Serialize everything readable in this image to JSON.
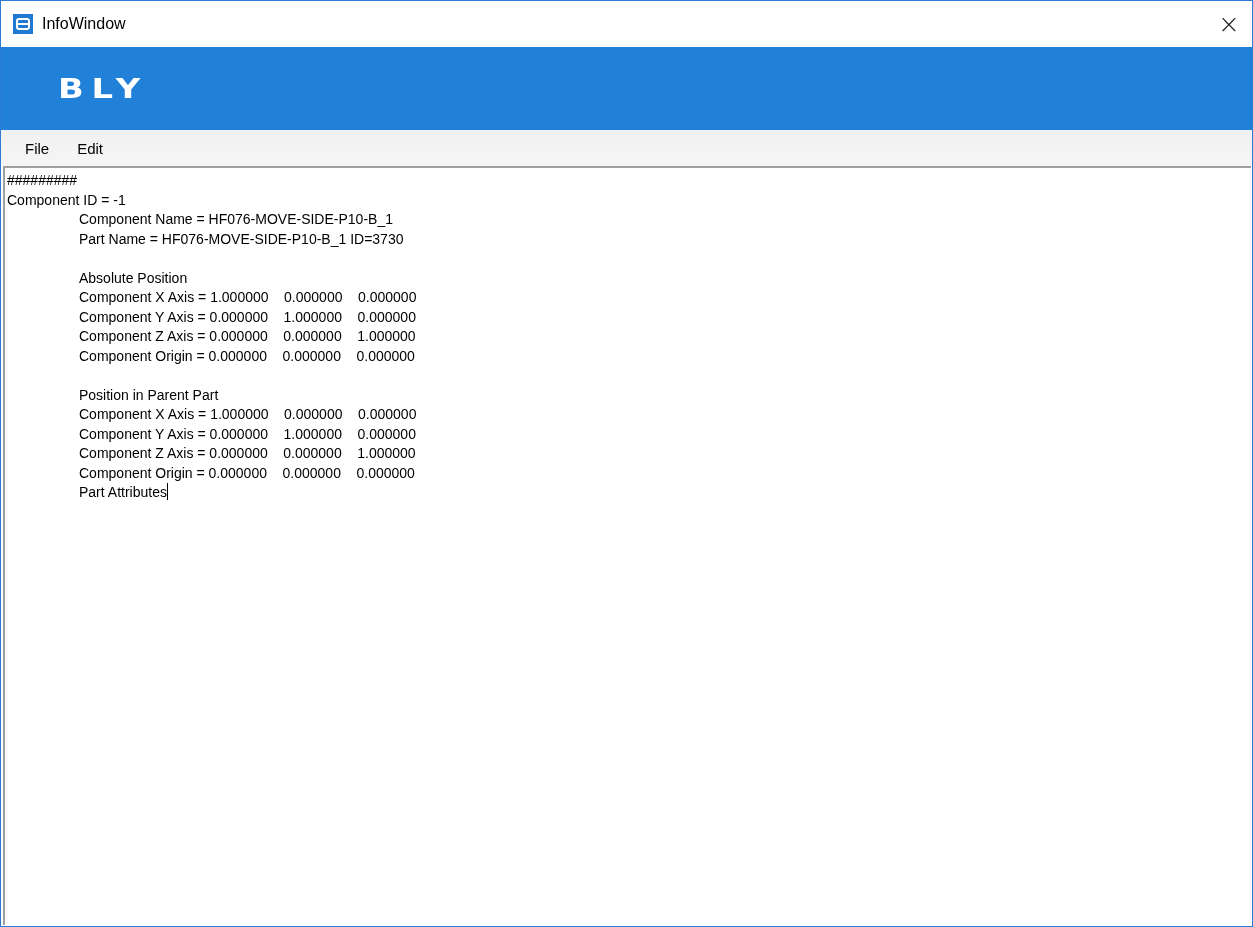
{
  "window": {
    "title": "InfoWindow",
    "close": "×"
  },
  "banner": {
    "logo": "BLY"
  },
  "menu": [
    "File",
    "Edit"
  ],
  "text_lines": [
    {
      "text": "#########",
      "indent": false,
      "gap_before": false
    },
    {
      "text": "Component ID = -1",
      "indent": false,
      "gap_before": false
    },
    {
      "text": "Component Name = HF076-MOVE-SIDE-P10-B_1",
      "indent": true,
      "gap_before": false
    },
    {
      "text": "Part Name = HF076-MOVE-SIDE-P10-B_1 ID=3730",
      "indent": true,
      "gap_before": false
    },
    {
      "text": "Absolute Position",
      "indent": true,
      "gap_before": true
    },
    {
      "text": "Component X Axis = 1.000000\t0.000000\t0.000000",
      "indent": true,
      "gap_before": false
    },
    {
      "text": "Component Y Axis = 0.000000\t1.000000\t0.000000",
      "indent": true,
      "gap_before": false
    },
    {
      "text": "Component Z Axis = 0.000000\t0.000000\t1.000000",
      "indent": true,
      "gap_before": false
    },
    {
      "text": "Component Origin = 0.000000\t0.000000\t0.000000",
      "indent": true,
      "gap_before": false
    },
    {
      "text": "Position in Parent Part",
      "indent": true,
      "gap_before": true
    },
    {
      "text": "Component X Axis = 1.000000\t0.000000\t0.000000",
      "indent": true,
      "gap_before": false
    },
    {
      "text": "Component Y Axis = 0.000000\t1.000000\t0.000000",
      "indent": true,
      "gap_before": false
    },
    {
      "text": "Component Z Axis = 0.000000\t0.000000\t1.000000",
      "indent": true,
      "gap_before": false
    },
    {
      "text": "Component Origin = 0.000000\t0.000000\t0.000000",
      "indent": true,
      "gap_before": false
    },
    {
      "text": "Part Attributes",
      "indent": true,
      "gap_before": false
    }
  ]
}
